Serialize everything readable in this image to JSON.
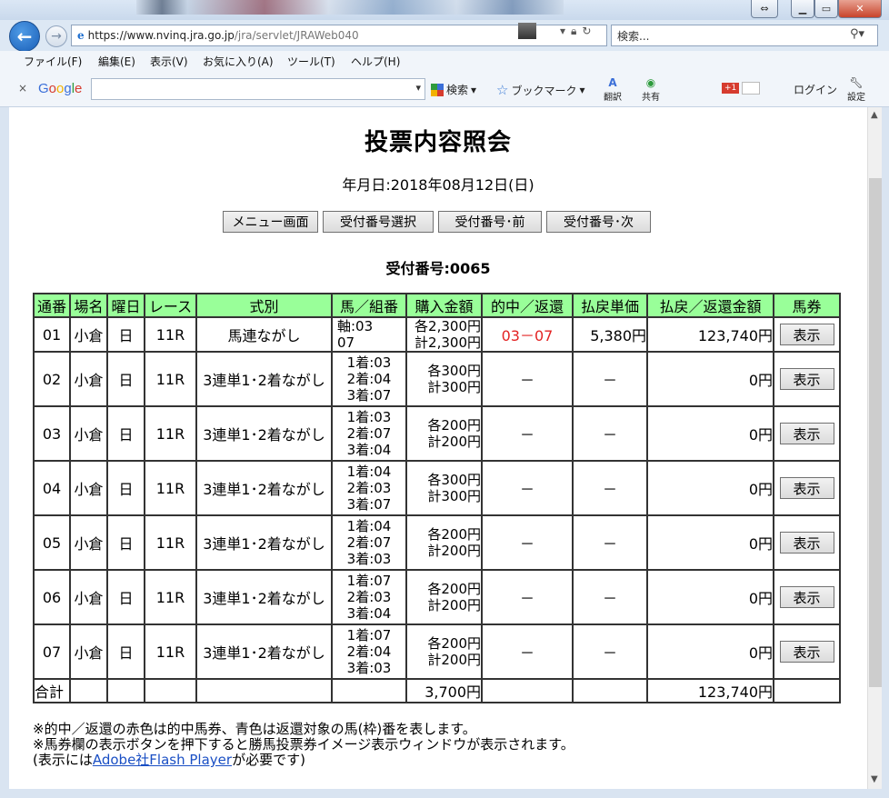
{
  "browser": {
    "url_host": "https://www.nvinq.jra.go.jp",
    "url_path": "/jra/servlet/JRAWeb040",
    "search_placeholder": "検索...",
    "menu": [
      "ファイル(F)",
      "編集(E)",
      "表示(V)",
      "お気に入り(A)",
      "ツール(T)",
      "ヘルプ(H)"
    ],
    "google_toolbar": {
      "logo": "Google",
      "search_label": "検索",
      "bookmark_label": "ブックマーク",
      "translate_label": "翻訳",
      "share_label": "共有",
      "login_label": "ログイン",
      "settings_label": "設定",
      "gplus_label": "+1"
    }
  },
  "page": {
    "title": "投票内容照会",
    "date_line": "年月日:2018年08月12日(日)",
    "buttons": [
      "メニュー画面",
      "受付番号選択",
      "受付番号･前",
      "受付番号･次"
    ],
    "receipt_line": "受付番号:0065"
  },
  "table": {
    "headers": [
      "通番",
      "場名",
      "曜日",
      "レース",
      "式別",
      "馬／組番",
      "購入金額",
      "的中／返還",
      "払戻単価",
      "払戻／返還金額",
      "馬券"
    ],
    "rows": [
      {
        "no": "01",
        "venue": "小倉",
        "day": "日",
        "race": "11R",
        "type": "馬連ながし",
        "combo": [
          "軸:03",
          "07"
        ],
        "amount": [
          "各2,300円",
          "計2,300円"
        ],
        "hit": "03－07",
        "unit": "5,380円",
        "payout": "123,740円",
        "ticket": "表示"
      },
      {
        "no": "02",
        "venue": "小倉",
        "day": "日",
        "race": "11R",
        "type": "3連単1･2着ながし",
        "combo": [
          "1着:03",
          "2着:04",
          "3着:07"
        ],
        "amount": [
          "各300円",
          "計300円"
        ],
        "hit": "－",
        "unit": "－",
        "payout": "0円",
        "ticket": "表示"
      },
      {
        "no": "03",
        "venue": "小倉",
        "day": "日",
        "race": "11R",
        "type": "3連単1･2着ながし",
        "combo": [
          "1着:03",
          "2着:07",
          "3着:04"
        ],
        "amount": [
          "各200円",
          "計200円"
        ],
        "hit": "－",
        "unit": "－",
        "payout": "0円",
        "ticket": "表示"
      },
      {
        "no": "04",
        "venue": "小倉",
        "day": "日",
        "race": "11R",
        "type": "3連単1･2着ながし",
        "combo": [
          "1着:04",
          "2着:03",
          "3着:07"
        ],
        "amount": [
          "各300円",
          "計300円"
        ],
        "hit": "－",
        "unit": "－",
        "payout": "0円",
        "ticket": "表示"
      },
      {
        "no": "05",
        "venue": "小倉",
        "day": "日",
        "race": "11R",
        "type": "3連単1･2着ながし",
        "combo": [
          "1着:04",
          "2着:07",
          "3着:03"
        ],
        "amount": [
          "各200円",
          "計200円"
        ],
        "hit": "－",
        "unit": "－",
        "payout": "0円",
        "ticket": "表示"
      },
      {
        "no": "06",
        "venue": "小倉",
        "day": "日",
        "race": "11R",
        "type": "3連単1･2着ながし",
        "combo": [
          "1着:07",
          "2着:03",
          "3着:04"
        ],
        "amount": [
          "各200円",
          "計200円"
        ],
        "hit": "－",
        "unit": "－",
        "payout": "0円",
        "ticket": "表示"
      },
      {
        "no": "07",
        "venue": "小倉",
        "day": "日",
        "race": "11R",
        "type": "3連単1･2着ながし",
        "combo": [
          "1着:07",
          "2着:04",
          "3着:03"
        ],
        "amount": [
          "各200円",
          "計200円"
        ],
        "hit": "－",
        "unit": "－",
        "payout": "0円",
        "ticket": "表示"
      }
    ],
    "total": {
      "label": "合計",
      "amount": "3,700円",
      "payout": "123,740円"
    }
  },
  "notes": {
    "line1": "※的中／返還の赤色は的中馬券、青色は返還対象の馬(枠)番を表します。",
    "line2": "※馬券欄の表示ボタンを押下すると勝馬投票券イメージ表示ウィンドウが表示されます。",
    "line3_pre": "(表示には",
    "line3_link": "Adobe社Flash Player",
    "line3_post": "が必要です)"
  },
  "colors": {
    "header_bg": "#99ff99",
    "hit_red": "#e32323",
    "link_blue": "#1a4fc4"
  }
}
